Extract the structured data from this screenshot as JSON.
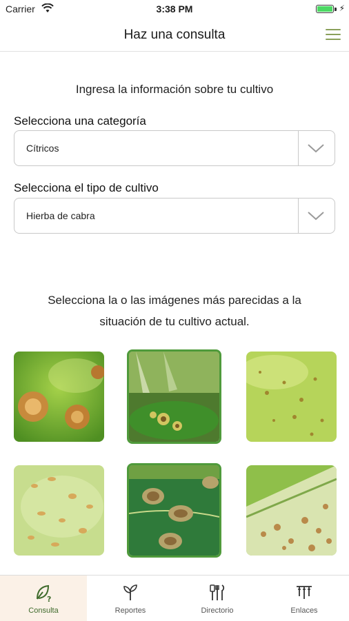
{
  "status_bar": {
    "carrier": "Carrier",
    "time": "3:38 PM"
  },
  "nav": {
    "title": "Haz una consulta"
  },
  "form": {
    "intro": "Ingresa la información sobre tu cultivo",
    "category_label": "Selecciona una categoría",
    "category_value": "Cítricos",
    "crop_label": "Selecciona el tipo de cultivo",
    "crop_value": "Hierba de cabra"
  },
  "images_section": {
    "instruction_line1": "Selecciona la o las imágenes más parecidas a la",
    "instruction_line2": "situación de tu cultivo actual.",
    "thumbnails": [
      {
        "selected": false
      },
      {
        "selected": true
      },
      {
        "selected": false
      },
      {
        "selected": false
      },
      {
        "selected": true
      },
      {
        "selected": false
      }
    ]
  },
  "tab_bar": {
    "tabs": [
      {
        "label": "Consulta",
        "icon": "leaf-question-icon",
        "active": true
      },
      {
        "label": "Reportes",
        "icon": "sprout-icon",
        "active": false
      },
      {
        "label": "Directorio",
        "icon": "tools-icon",
        "active": false
      },
      {
        "label": "Enlaces",
        "icon": "link-tools-icon",
        "active": false
      }
    ]
  },
  "colors": {
    "accent": "#4f9a3b",
    "menu_icon": "#8aa05a",
    "active_tab_bg": "#fbf1e7"
  }
}
